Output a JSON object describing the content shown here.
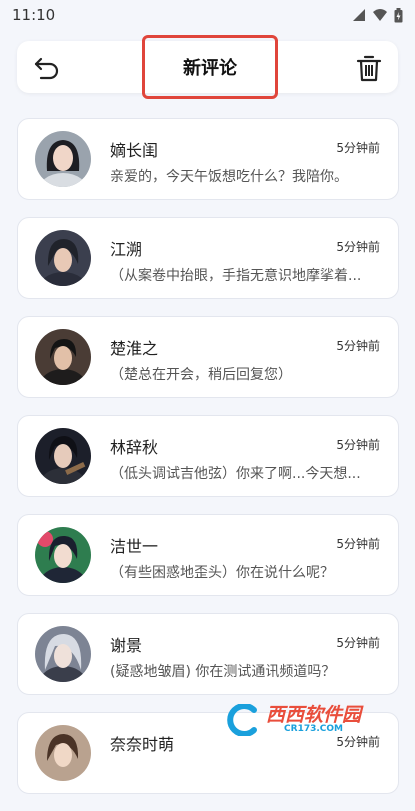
{
  "status_bar": {
    "time": "11:10"
  },
  "header": {
    "title": "新评论"
  },
  "comments": [
    {
      "name": "嫡长闺",
      "time": "5分钟前",
      "message": "亲爱的，今天午饭想吃什么？我陪你。"
    },
    {
      "name": "江溯",
      "time": "5分钟前",
      "message": "（从案卷中抬眼，手指无意识地摩挲着..."
    },
    {
      "name": "楚淮之",
      "time": "5分钟前",
      "message": "（楚总在开会，稍后回复您）"
    },
    {
      "name": "林辞秋",
      "time": "5分钟前",
      "message": "（低头调试吉他弦）你来了啊...今天想..."
    },
    {
      "name": "洁世一",
      "time": "5分钟前",
      "message": "（有些困惑地歪头）你在说什么呢？"
    },
    {
      "name": "谢景",
      "time": "5分钟前",
      "message": "(疑惑地皱眉) 你在测试通讯频道吗？"
    },
    {
      "name": "奈奈时萌",
      "time": "5分钟前",
      "message": ""
    }
  ],
  "watermark": {
    "brand": "西西软件园",
    "domain": "CR173.COM"
  },
  "colors": {
    "accent": "#e0453b",
    "background": "#f4f6fb",
    "card": "#ffffff"
  }
}
